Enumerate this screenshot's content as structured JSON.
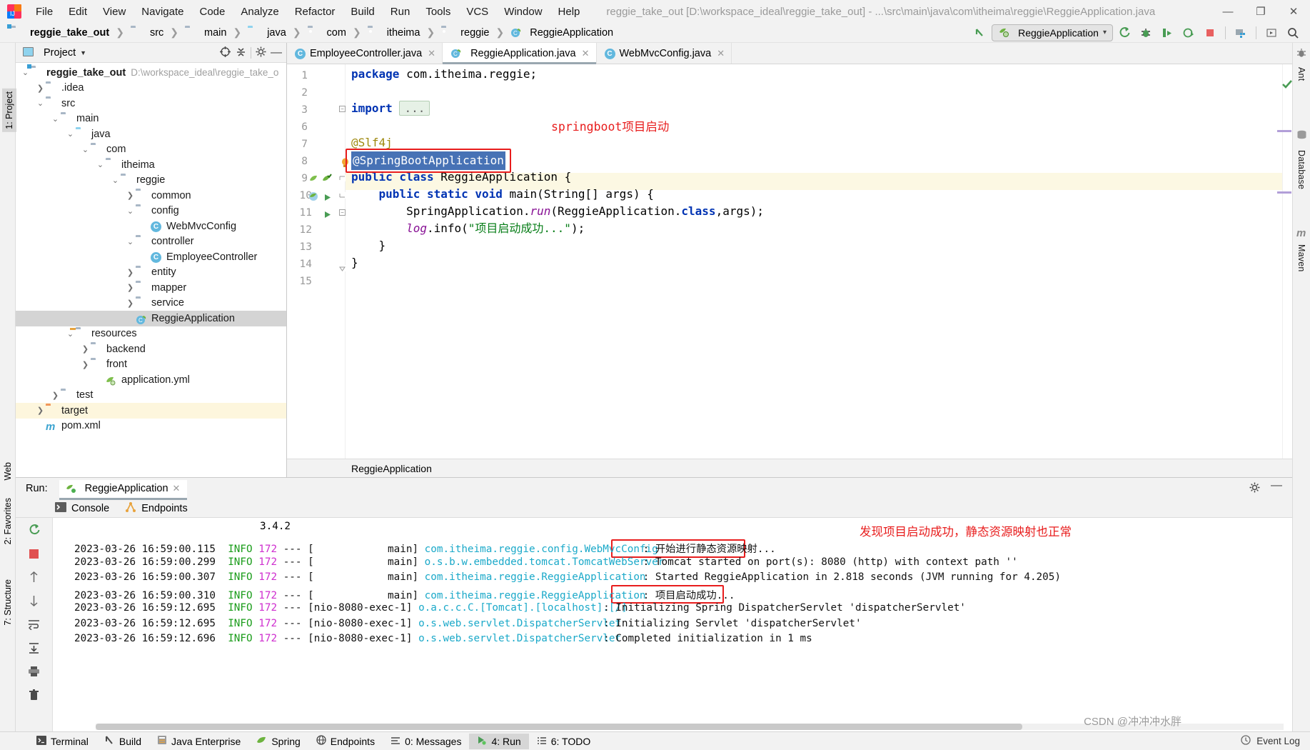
{
  "window": {
    "title": "reggie_take_out [D:\\workspace_ideal\\reggie_take_out] - ...\\src\\main\\java\\com\\itheima\\reggie\\ReggieApplication.java",
    "minimize": "—",
    "maximize": "❐",
    "close": "✕"
  },
  "menu": [
    "File",
    "Edit",
    "View",
    "Navigate",
    "Code",
    "Analyze",
    "Refactor",
    "Build",
    "Run",
    "Tools",
    "VCS",
    "Window",
    "Help"
  ],
  "breadcrumb": [
    {
      "label": "reggie_take_out",
      "icon": "module-icon"
    },
    {
      "label": "src",
      "icon": "folder-icon"
    },
    {
      "label": "main",
      "icon": "folder-icon"
    },
    {
      "label": "java",
      "icon": "source-folder-icon"
    },
    {
      "label": "com",
      "icon": "package-icon"
    },
    {
      "label": "itheima",
      "icon": "package-icon"
    },
    {
      "label": "reggie",
      "icon": "package-icon"
    },
    {
      "label": "ReggieApplication",
      "icon": "spring-class-icon"
    }
  ],
  "toolbar": {
    "run_config": "ReggieApplication",
    "buttons": [
      "run-button",
      "debug-button",
      "run-with-coverage-button",
      "profile-button",
      "stop-button",
      "build-project-button",
      "search-everywhere-button"
    ]
  },
  "project_panel": {
    "title": "Project",
    "tree": [
      {
        "depth": 0,
        "arrow": "down",
        "icon": "module-icon",
        "label": "reggie_take_out",
        "bold": true,
        "path": "D:\\workspace_ideal\\reggie_take_o"
      },
      {
        "depth": 1,
        "arrow": "right",
        "icon": "folder-icon",
        "label": ".idea"
      },
      {
        "depth": 1,
        "arrow": "down",
        "icon": "folder-icon",
        "label": "src"
      },
      {
        "depth": 2,
        "arrow": "down",
        "icon": "folder-icon",
        "label": "main"
      },
      {
        "depth": 3,
        "arrow": "down",
        "icon": "source-folder-icon",
        "label": "java"
      },
      {
        "depth": 4,
        "arrow": "down",
        "icon": "package-icon",
        "label": "com"
      },
      {
        "depth": 5,
        "arrow": "down",
        "icon": "package-icon",
        "label": "itheima"
      },
      {
        "depth": 6,
        "arrow": "down",
        "icon": "package-icon",
        "label": "reggie"
      },
      {
        "depth": 7,
        "arrow": "right",
        "icon": "package-icon",
        "label": "common"
      },
      {
        "depth": 7,
        "arrow": "down",
        "icon": "package-icon",
        "label": "config"
      },
      {
        "depth": 8,
        "arrow": "none",
        "icon": "class-icon",
        "label": "WebMvcConfig"
      },
      {
        "depth": 7,
        "arrow": "down",
        "icon": "package-icon",
        "label": "controller"
      },
      {
        "depth": 8,
        "arrow": "none",
        "icon": "class-icon",
        "label": "EmployeeController"
      },
      {
        "depth": 7,
        "arrow": "right",
        "icon": "package-icon",
        "label": "entity"
      },
      {
        "depth": 7,
        "arrow": "right",
        "icon": "package-icon",
        "label": "mapper"
      },
      {
        "depth": 7,
        "arrow": "right",
        "icon": "package-icon",
        "label": "service"
      },
      {
        "depth": 7,
        "arrow": "none",
        "icon": "spring-class-icon",
        "label": "ReggieApplication",
        "selected": true
      },
      {
        "depth": 3,
        "arrow": "down",
        "icon": "resource-folder-icon",
        "label": "resources"
      },
      {
        "depth": 4,
        "arrow": "right",
        "icon": "folder-icon",
        "label": "backend"
      },
      {
        "depth": 4,
        "arrow": "right",
        "icon": "folder-icon",
        "label": "front"
      },
      {
        "depth": 5,
        "arrow": "none",
        "icon": "spring-yml-icon",
        "label": "application.yml"
      },
      {
        "depth": 2,
        "arrow": "right",
        "icon": "folder-icon",
        "label": "test"
      },
      {
        "depth": 1,
        "arrow": "right",
        "icon": "excluded-folder-icon",
        "label": "target",
        "warn": true
      },
      {
        "depth": 1,
        "arrow": "none",
        "icon": "maven-icon",
        "label": "pom.xml"
      }
    ]
  },
  "editor": {
    "tabs": [
      {
        "label": "EmployeeController.java",
        "icon": "class-icon",
        "active": false
      },
      {
        "label": "ReggieApplication.java",
        "icon": "spring-class-icon",
        "active": true
      },
      {
        "label": "WebMvcConfig.java",
        "icon": "class-icon",
        "active": false
      }
    ],
    "line_numbers": [
      "1",
      "2",
      "3",
      "6",
      "7",
      "8",
      "9",
      "10",
      "11",
      "12",
      "13",
      "14",
      "15"
    ],
    "lines": [
      {
        "n": "1",
        "text": "package com.itheima.reggie;"
      },
      {
        "n": "2",
        "text": ""
      },
      {
        "n": "3",
        "text": "import ..."
      },
      {
        "n": "6",
        "text": ""
      },
      {
        "n": "7",
        "text": "@Slf4j"
      },
      {
        "n": "8",
        "text": "@SpringBootApplication"
      },
      {
        "n": "9",
        "text": "public class ReggieApplication {"
      },
      {
        "n": "10",
        "text": "    public static void main(String[] args) {"
      },
      {
        "n": "11",
        "text": "        SpringApplication.run(ReggieApplication.class,args);"
      },
      {
        "n": "12",
        "text": "        log.info(\"项目启动成功...\");"
      },
      {
        "n": "13",
        "text": "    }"
      },
      {
        "n": "14",
        "text": "}"
      },
      {
        "n": "15",
        "text": ""
      }
    ],
    "annotation_note": "springboot项目启动",
    "highlighted_token": "@SpringBootApplication",
    "footer_breadcrumb": "ReggieApplication"
  },
  "run_panel": {
    "label": "Run:",
    "tab": "ReggieApplication",
    "subtabs": [
      {
        "label": "Console",
        "icon": "console-icon"
      },
      {
        "label": "Endpoints",
        "icon": "endpoints-icon"
      }
    ],
    "version_line": "3.4.2",
    "note": "发现项目启动成功，静态资源映射也正常",
    "log": [
      {
        "date": "2023-03-26 16:59:00.115",
        "level": "INFO",
        "pid": "172",
        "sep": "--- [",
        "thread": "            main]",
        "logger": "com.itheima.reggie.config.WebMvcConfig",
        "msg": ": 开始进行静态资源映射...",
        "boxed": true
      },
      {
        "date": "2023-03-26 16:59:00.299",
        "level": "INFO",
        "pid": "172",
        "sep": "--- [",
        "thread": "            main]",
        "logger": "o.s.b.w.embedded.tomcat.TomcatWebServer",
        "msg": ": Tomcat started on port(s): 8080 (http) with context path ''"
      },
      {
        "date": "2023-03-26 16:59:00.307",
        "level": "INFO",
        "pid": "172",
        "sep": "--- [",
        "thread": "            main]",
        "logger": "com.itheima.reggie.ReggieApplication",
        "msg": ": Started ReggieApplication in 2.818 seconds (JVM running for 4.205)"
      },
      {
        "date": "2023-03-26 16:59:00.310",
        "level": "INFO",
        "pid": "172",
        "sep": "--- [",
        "thread": "            main]",
        "logger": "com.itheima.reggie.ReggieApplication",
        "msg": ": 项目启动成功...",
        "boxed": true
      },
      {
        "date": "2023-03-26 16:59:12.695",
        "level": "INFO",
        "pid": "172",
        "sep": "--- [",
        "thread": "nio-8080-exec-1]",
        "logger": "o.a.c.c.C.[Tomcat].[localhost].[/]",
        "msg": ": Initializing Spring DispatcherServlet 'dispatcherServlet'"
      },
      {
        "date": "2023-03-26 16:59:12.695",
        "level": "INFO",
        "pid": "172",
        "sep": "--- [",
        "thread": "nio-8080-exec-1]",
        "logger": "o.s.web.servlet.DispatcherServlet",
        "msg": ": Initializing Servlet 'dispatcherServlet'"
      },
      {
        "date": "2023-03-26 16:59:12.696",
        "level": "INFO",
        "pid": "172",
        "sep": "--- [",
        "thread": "nio-8080-exec-1]",
        "logger": "o.s.web.servlet.DispatcherServlet",
        "msg": ": Completed initialization in 1 ms"
      }
    ]
  },
  "left_strip": [
    {
      "label": "1: Project",
      "selected": true
    },
    {
      "label": "7: Structure",
      "selected": false
    },
    {
      "label": "2: Favorites",
      "selected": false
    },
    {
      "label": "Web",
      "selected": false
    }
  ],
  "right_strip": [
    {
      "label": "Ant"
    },
    {
      "label": "Database"
    },
    {
      "label": "Maven"
    }
  ],
  "status_bar": {
    "items": [
      {
        "label": "Terminal",
        "icon": "terminal-icon"
      },
      {
        "label": "Build",
        "icon": "build-icon"
      },
      {
        "label": "Java Enterprise",
        "icon": "java-ee-icon"
      },
      {
        "label": "Spring",
        "icon": "spring-icon"
      },
      {
        "label": "Endpoints",
        "icon": "endpoints-icon"
      },
      {
        "label": "0: Messages",
        "icon": "messages-icon"
      },
      {
        "label": "4: Run",
        "icon": "run-icon",
        "selected": true
      },
      {
        "label": "6: TODO",
        "icon": "todo-icon"
      }
    ],
    "event_log": "Event Log"
  },
  "watermark": "CSDN @冲冲冲水胖",
  "colors": {
    "accent_red": "#e81d1d",
    "keyword_blue": "#0033b3",
    "string_green": "#067d17",
    "annotation_gold": "#9e880d",
    "selection_blue": "#4772b5",
    "logger_cyan": "#1ba9c9",
    "info_green": "#1a9c1a",
    "pid_magenta": "#cf2fcf"
  }
}
